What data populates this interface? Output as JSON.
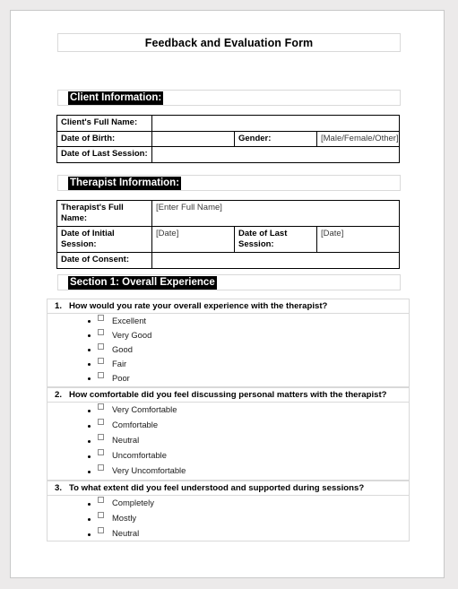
{
  "document": {
    "title": "Feedback and Evaluation Form"
  },
  "sections": {
    "client": {
      "heading": "Client Information:",
      "rows": [
        {
          "label": "Client's Full Name:",
          "value": ""
        },
        {
          "label": "Date of Birth:",
          "value": "",
          "label2": "Gender:",
          "value2": "[Male/Female/Other]"
        },
        {
          "label": "Date of Last Session:",
          "value": ""
        }
      ]
    },
    "therapist": {
      "heading": "Therapist Information:",
      "rows": [
        {
          "label": "Therapist's Full Name:",
          "value": "[Enter Full Name]"
        },
        {
          "label": "Date of Initial Session:",
          "value": "[Date]",
          "label2": "Date of Last Session:",
          "value2": "[Date]"
        },
        {
          "label": "Date of Consent:",
          "value": ""
        }
      ]
    },
    "section1": {
      "heading": "Section 1: Overall Experience",
      "questions": [
        {
          "number": "1.",
          "text": "How would you rate your overall experience with the therapist?",
          "options": [
            "Excellent",
            "Very Good",
            "Good",
            "Fair",
            "Poor"
          ]
        },
        {
          "number": "2.",
          "text": "How comfortable did you feel discussing personal matters with the therapist?",
          "options": [
            "Very Comfortable",
            "Comfortable",
            "Neutral",
            "Uncomfortable",
            "Very Uncomfortable"
          ]
        },
        {
          "number": "3.",
          "text": "To what extent did you feel understood and supported during sessions?",
          "options": [
            "Completely",
            "Mostly",
            "Neutral"
          ]
        }
      ]
    }
  },
  "colors": {
    "highlight_bg": "#000000",
    "highlight_fg": "#ffffff",
    "page_bg": "#ffffff",
    "canvas_bg": "#eceaea",
    "table_border": "#000000",
    "light_border": "#d9d9d9"
  }
}
